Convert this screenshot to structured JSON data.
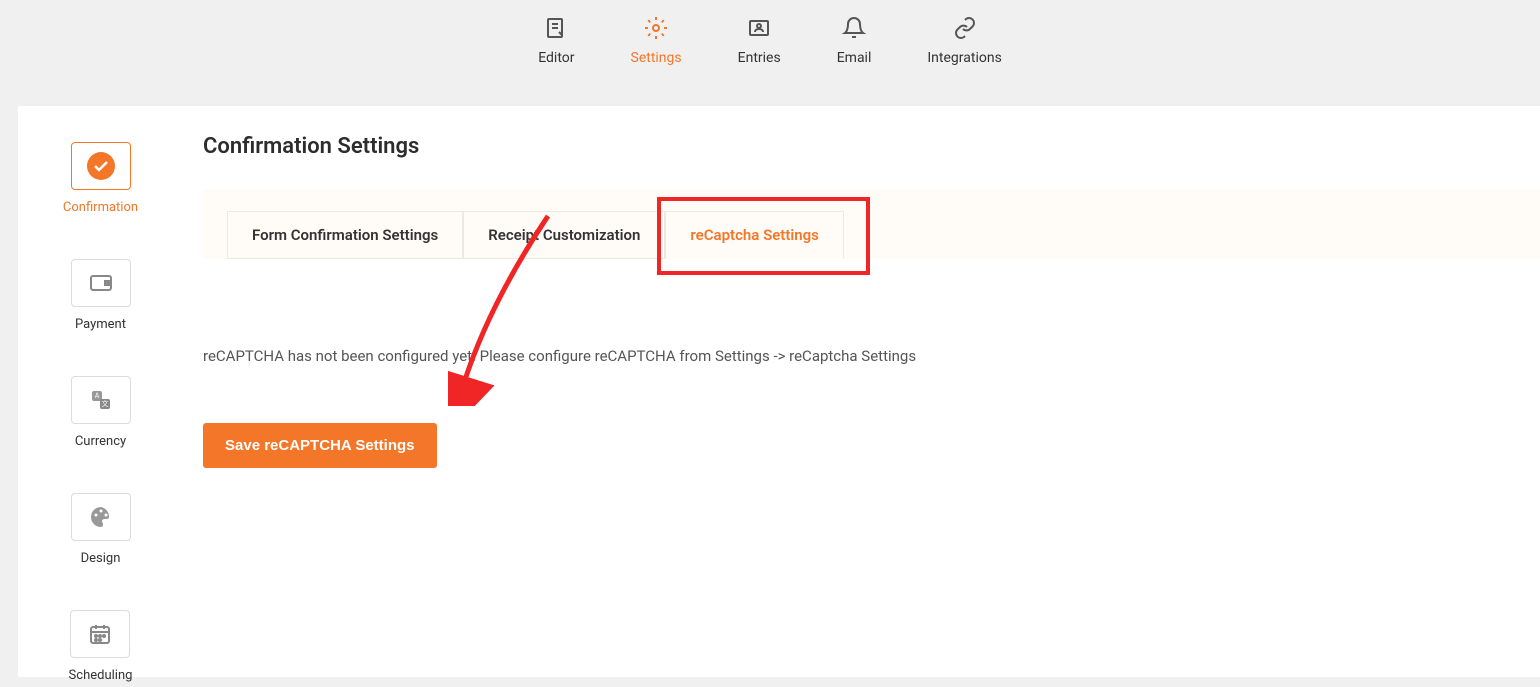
{
  "topNav": {
    "items": [
      {
        "label": "Editor",
        "icon": "editor"
      },
      {
        "label": "Settings",
        "icon": "settings",
        "active": true
      },
      {
        "label": "Entries",
        "icon": "entries"
      },
      {
        "label": "Email",
        "icon": "email"
      },
      {
        "label": "Integrations",
        "icon": "integrations"
      }
    ]
  },
  "sidebar": {
    "items": [
      {
        "label": "Confirmation",
        "icon": "check",
        "active": true
      },
      {
        "label": "Payment",
        "icon": "wallet"
      },
      {
        "label": "Currency",
        "icon": "currency"
      },
      {
        "label": "Design",
        "icon": "palette"
      },
      {
        "label": "Scheduling",
        "icon": "calendar"
      }
    ]
  },
  "page": {
    "title": "Confirmation Settings"
  },
  "tabs": {
    "items": [
      {
        "label": "Form Confirmation Settings"
      },
      {
        "label": "Receipt Customization"
      },
      {
        "label": "reCaptcha Settings",
        "active": true
      }
    ]
  },
  "body": {
    "notice": "reCAPTCHA has not been configured yet! Please configure reCAPTCHA from Settings -> reCaptcha Settings",
    "saveButton": "Save reCAPTCHA Settings"
  },
  "colors": {
    "accent": "#f47629",
    "highlight": "#f02525"
  }
}
